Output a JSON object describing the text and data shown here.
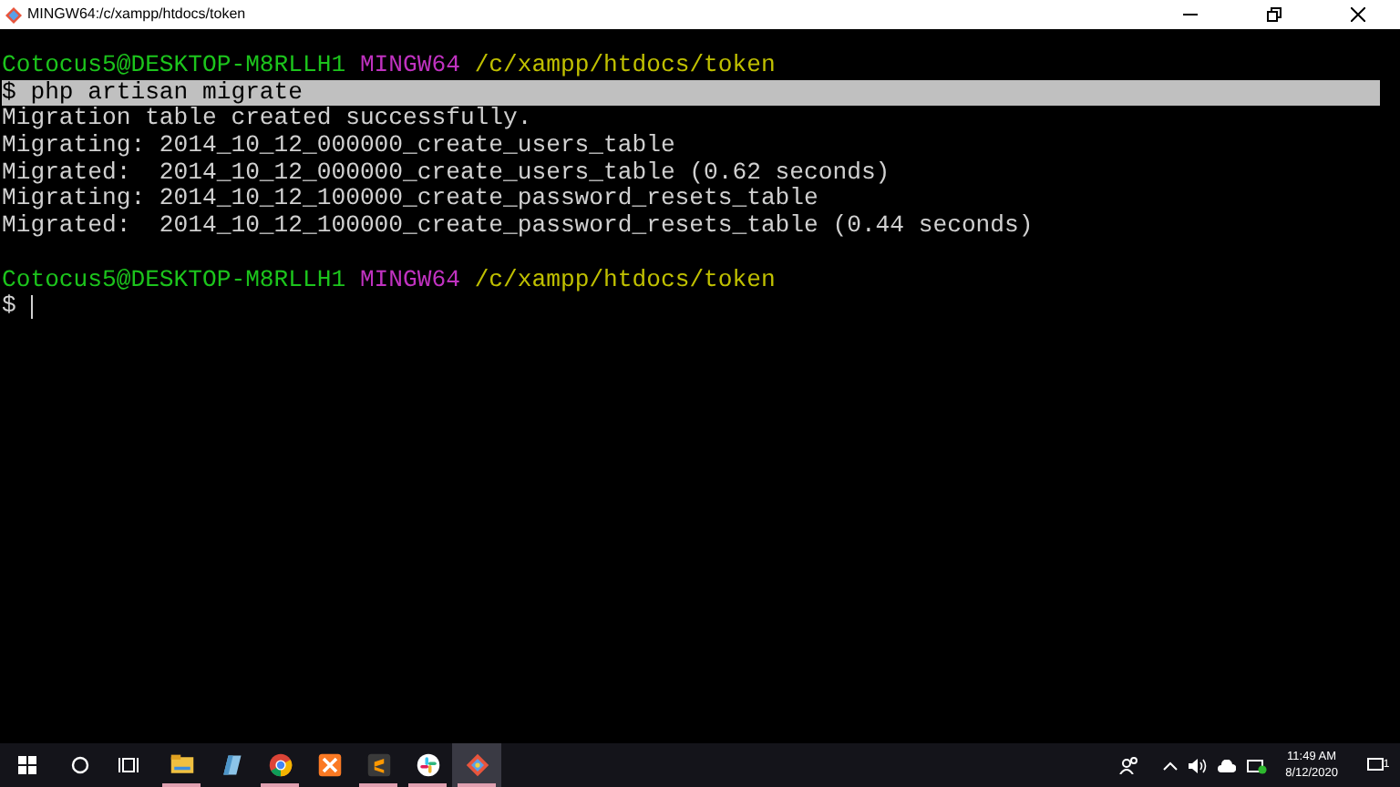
{
  "window": {
    "title": "MINGW64:/c/xampp/htdocs/token"
  },
  "terminal": {
    "lines": [
      {
        "kind": "prompt",
        "user": "Cotocus5@DESKTOP-M8RLLH1",
        "system": "MINGW64",
        "path": "/c/xampp/htdocs/token"
      },
      {
        "kind": "command",
        "text": "$ php artisan migrate",
        "selected": true
      },
      {
        "kind": "output",
        "text": "Migration table created successfully."
      },
      {
        "kind": "output",
        "text": "Migrating: 2014_10_12_000000_create_users_table"
      },
      {
        "kind": "output",
        "text": "Migrated:  2014_10_12_000000_create_users_table (0.62 seconds)"
      },
      {
        "kind": "output",
        "text": "Migrating: 2014_10_12_100000_create_password_resets_table"
      },
      {
        "kind": "output",
        "text": "Migrated:  2014_10_12_100000_create_password_resets_table (0.44 seconds)"
      },
      {
        "kind": "blank"
      },
      {
        "kind": "prompt",
        "user": "Cotocus5@DESKTOP-M8RLLH1",
        "system": "MINGW64",
        "path": "/c/xampp/htdocs/token"
      },
      {
        "kind": "input",
        "text": "$",
        "cursor": true
      }
    ]
  },
  "taskbar": {
    "apps": [
      {
        "kind": "explorer",
        "running": true,
        "selected": false
      },
      {
        "kind": "notepad",
        "running": false,
        "selected": false
      },
      {
        "kind": "chrome",
        "running": true,
        "selected": false
      },
      {
        "kind": "xampp",
        "running": false,
        "selected": false
      },
      {
        "kind": "sublime",
        "running": true,
        "selected": false
      },
      {
        "kind": "slack",
        "running": true,
        "selected": false
      },
      {
        "kind": "git",
        "running": true,
        "selected": true
      }
    ],
    "clock": {
      "time": "11:49 AM",
      "date": "8/12/2020"
    },
    "notifications": "1"
  }
}
